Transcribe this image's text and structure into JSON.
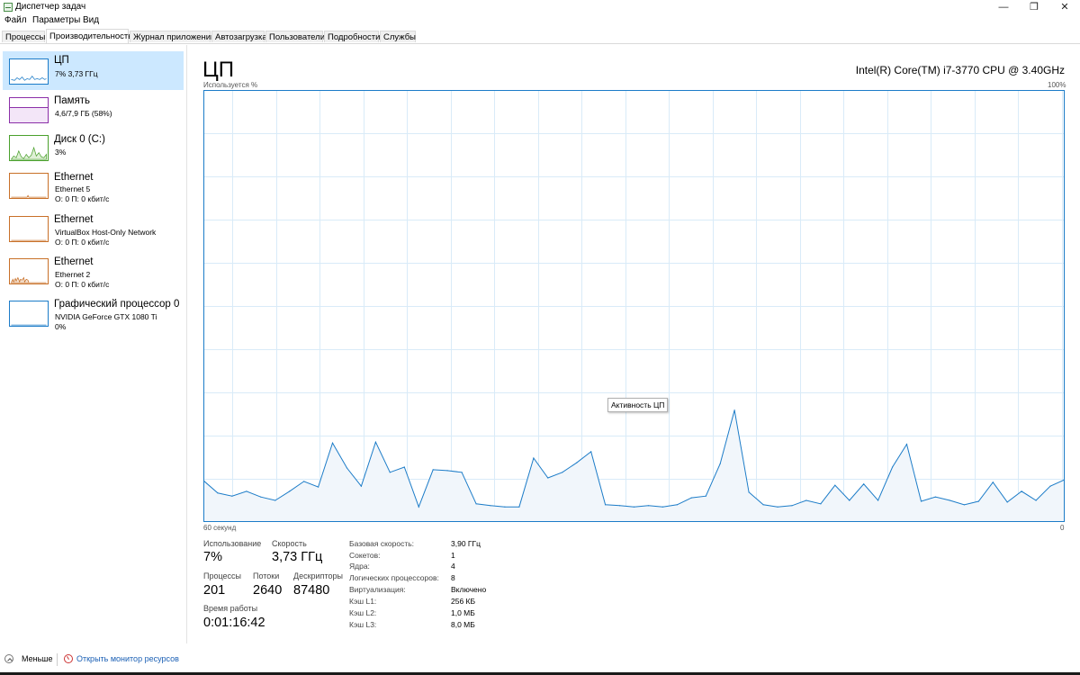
{
  "window": {
    "title": "Диспетчер задач",
    "controls": [
      "—",
      "❐",
      "✕"
    ]
  },
  "menu": [
    "Файл",
    "Параметры",
    "Вид"
  ],
  "tabs": [
    "Процессы",
    "Производительность",
    "Журнал приложений",
    "Автозагрузка",
    "Пользователи",
    "Подробности",
    "Службы"
  ],
  "active_tab": "Производительность",
  "sidebar": [
    {
      "title": "ЦП",
      "sub1": "7% 3,73 ГГц",
      "sub2": "",
      "color": "#1c7cc8",
      "selected": true
    },
    {
      "title": "Память",
      "sub1": "4,6/7,9 ГБ (58%)",
      "sub2": "",
      "color": "#8b2fa8",
      "selected": false
    },
    {
      "title": "Диск 0 (C:)",
      "sub1": "3%",
      "sub2": "",
      "color": "#4aa02c",
      "selected": false
    },
    {
      "title": "Ethernet",
      "sub1": "Ethernet 5",
      "sub2": "О: 0 П: 0 кбит/с",
      "color": "#c87028",
      "selected": false
    },
    {
      "title": "Ethernet",
      "sub1": "VirtualBox Host-Only Network",
      "sub2": "О: 0 П: 0 кбит/с",
      "color": "#c87028",
      "selected": false
    },
    {
      "title": "Ethernet",
      "sub1": "Ethernet 2",
      "sub2": "О: 0 П: 0 кбит/с",
      "color": "#c87028",
      "selected": false
    },
    {
      "title": "Графический процессор 0",
      "sub1": "NVIDIA GeForce GTX 1080 Ti",
      "sub2": "0%",
      "color": "#1c7cc8",
      "selected": false
    }
  ],
  "main": {
    "title": "ЦП",
    "cpu_model": "Intel(R) Core(TM) i7-3770 CPU @ 3.40GHz",
    "y_label": "Используется %",
    "y_max_label": "100%",
    "x_left_label": "60 секунд",
    "x_right_label": "0",
    "tooltip": "Активность ЦП"
  },
  "chart_data": {
    "type": "area",
    "ylim": [
      0,
      100
    ],
    "xlim": [
      60,
      0
    ],
    "x": [
      60,
      59,
      58,
      57,
      56,
      55,
      54,
      53,
      52,
      51,
      50,
      49,
      48,
      47,
      46,
      45,
      44,
      43,
      42,
      41,
      40,
      39,
      38,
      37,
      36,
      35,
      34,
      33,
      32,
      31,
      30,
      29,
      28,
      27,
      26,
      25,
      24,
      23,
      22,
      21,
      20,
      19,
      18,
      17,
      16,
      15,
      14,
      13,
      12,
      11,
      10,
      9,
      8,
      7,
      6,
      5,
      4,
      3,
      2,
      1,
      0
    ],
    "y": [
      9.6,
      6.7,
      6.0,
      7.1,
      5.8,
      5.0,
      7.1,
      9.4,
      8.1,
      18.3,
      12.5,
      8.3,
      18.5,
      11.5,
      12.7,
      3.5,
      12.1,
      11.9,
      11.5,
      4.2,
      3.8,
      3.5,
      3.5,
      14.8,
      10.2,
      11.5,
      13.7,
      16.3,
      4.0,
      3.8,
      3.5,
      3.8,
      3.5,
      4.0,
      5.6,
      6.0,
      13.5,
      25.9,
      6.9,
      4.0,
      3.5,
      3.8,
      5.0,
      4.2,
      8.5,
      5.0,
      8.8,
      5.0,
      12.7,
      18.0,
      4.8,
      5.8,
      5.0,
      4.0,
      4.8,
      9.2,
      4.6,
      7.1,
      5.0,
      8.3,
      9.8,
      7.1
    ]
  },
  "stats": {
    "usage": {
      "label": "Использование",
      "value": "7%"
    },
    "speed": {
      "label": "Скорость",
      "value": "3,73 ГГц"
    },
    "processes": {
      "label": "Процессы",
      "value": "201"
    },
    "threads": {
      "label": "Потоки",
      "value": "2640"
    },
    "handles": {
      "label": "Дескрипторы",
      "value": "87480"
    },
    "uptime": {
      "label": "Время работы",
      "value": "0:01:16:42"
    }
  },
  "specs": [
    {
      "label": "Базовая скорость:",
      "value": "3,90 ГГц"
    },
    {
      "label": "Сокетов:",
      "value": "1"
    },
    {
      "label": "Ядра:",
      "value": "4"
    },
    {
      "label": "Логических процессоров:",
      "value": "8"
    },
    {
      "label": "Виртуализация:",
      "value": "Включено"
    },
    {
      "label": "Кэш L1:",
      "value": "256 КБ"
    },
    {
      "label": "Кэш L2:",
      "value": "1,0 МБ"
    },
    {
      "label": "Кэш L3:",
      "value": "8,0 МБ"
    }
  ],
  "footer": {
    "fewer_details": "Меньше",
    "resource_monitor": "Открыть монитор ресурсов"
  },
  "colors": {
    "accent": "#1c7cc8",
    "grid": "#d9ebf8",
    "fill": "#f1f6fb",
    "selected_bg": "#cce8ff"
  }
}
